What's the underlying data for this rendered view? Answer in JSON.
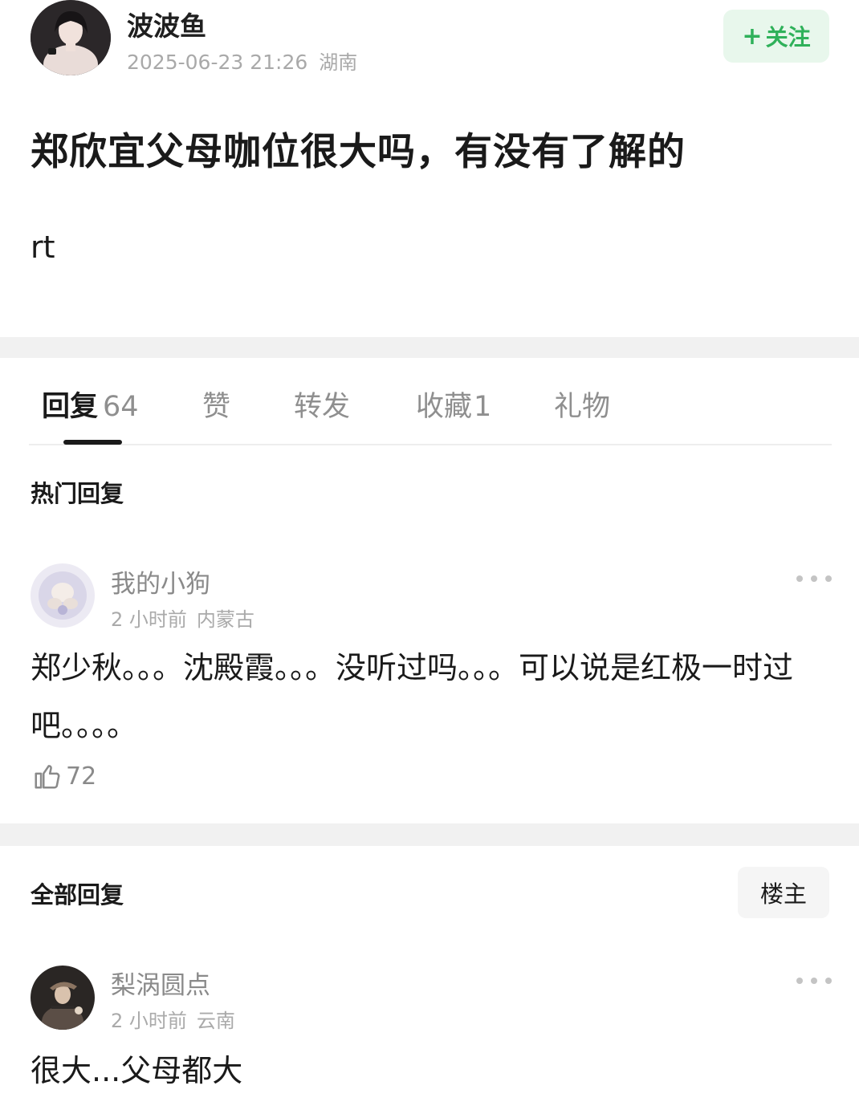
{
  "post": {
    "author": "波波鱼",
    "datetime": "2025-06-23 21:26",
    "location": "湖南",
    "follow_label": "关注",
    "follow_prefix": "+",
    "title": "郑欣宜父母咖位很大吗，有没有了解的",
    "body": "rt"
  },
  "tabs": [
    {
      "label": "回复",
      "count": "64",
      "active": true
    },
    {
      "label": "赞",
      "count": ""
    },
    {
      "label": "转发",
      "count": ""
    },
    {
      "label": "收藏",
      "count": "1"
    },
    {
      "label": "礼物",
      "count": ""
    }
  ],
  "hot_section": {
    "title": "热门回复",
    "reply": {
      "name": "我的小狗",
      "time": "2 小时前",
      "location": "内蒙古",
      "text": "郑少秋。。。沈殿霞。。。没听过吗。。。可以说是红极一时过吧。。。。",
      "likes": "72"
    }
  },
  "all_section": {
    "title": "全部回复",
    "filter_label": "楼主",
    "reply": {
      "name": "梨涡圆点",
      "time": "2 小时前",
      "location": "云南",
      "text": "很大...父母都大"
    }
  },
  "colors": {
    "accent_green": "#2fb15a",
    "follow_bg": "#e8f7ec",
    "meta_gray": "#a9a9a9",
    "divider": "#f1f1f1"
  },
  "icons": {
    "more": "more-dots-icon",
    "like": "thumbs-up-icon",
    "plus": "plus-icon"
  }
}
